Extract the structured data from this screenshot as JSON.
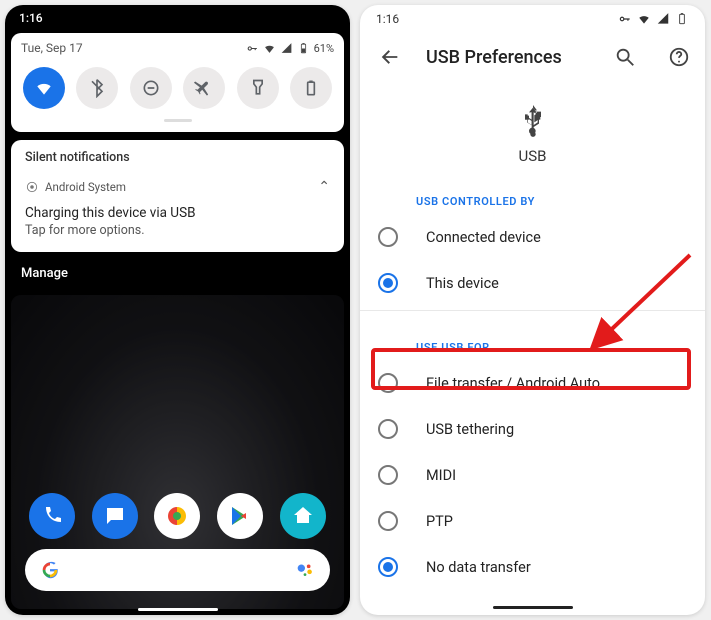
{
  "left": {
    "clock": "1:16",
    "date": "Tue, Sep 17",
    "battery_pct": "61%",
    "tiles": [
      {
        "name": "wifi",
        "active": true
      },
      {
        "name": "bluetooth",
        "active": false
      },
      {
        "name": "dnd",
        "active": false
      },
      {
        "name": "airplane",
        "active": false
      },
      {
        "name": "flashlight",
        "active": false
      },
      {
        "name": "battery",
        "active": false
      }
    ],
    "silent_header": "Silent notifications",
    "notif_app": "Android System",
    "notif_title": "Charging this device via USB",
    "notif_sub": "Tap for more options.",
    "manage": "Manage"
  },
  "right": {
    "clock": "1:16",
    "title": "USB Preferences",
    "hero_label": "USB",
    "section1": "USB CONTROLLED BY",
    "controlled": [
      {
        "label": "Connected device",
        "checked": false
      },
      {
        "label": "This device",
        "checked": true
      }
    ],
    "section2": "USE USB FOR",
    "use_for": [
      {
        "label": "File transfer / Android Auto",
        "checked": false
      },
      {
        "label": "USB tethering",
        "checked": false
      },
      {
        "label": "MIDI",
        "checked": false
      },
      {
        "label": "PTP",
        "checked": false
      },
      {
        "label": "No data transfer",
        "checked": true
      }
    ]
  },
  "annotation": {
    "highlight_target": "File transfer / Android Auto"
  }
}
